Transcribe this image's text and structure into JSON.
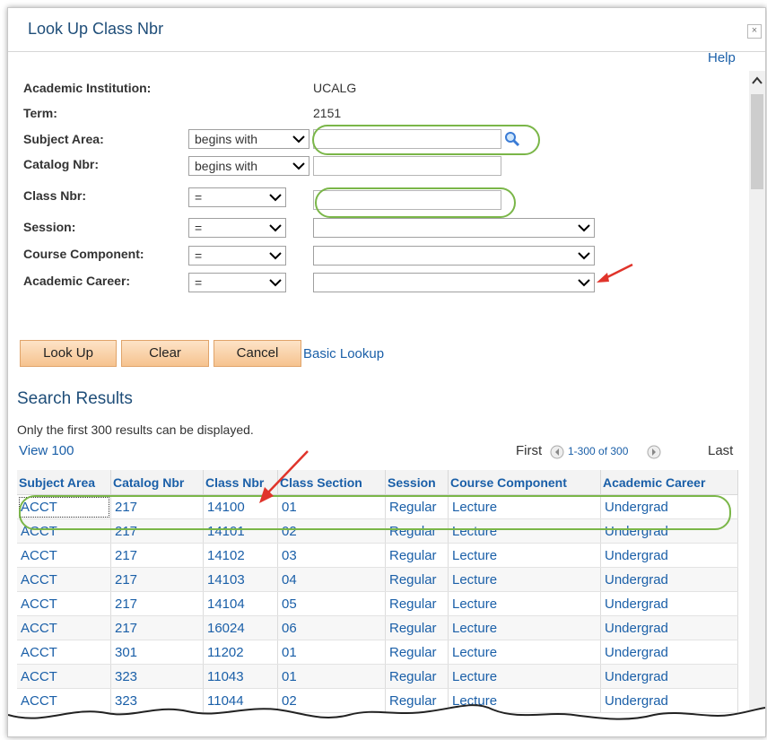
{
  "dialog": {
    "title": "Look Up Class Nbr",
    "close_glyph": "×",
    "help": "Help"
  },
  "fields": {
    "academic_institution": {
      "label": "Academic Institution:",
      "value": "UCALG"
    },
    "term": {
      "label": "Term:",
      "value": "2151"
    },
    "subject_area": {
      "label": "Subject Area:",
      "operator": "begins with"
    },
    "catalog_nbr": {
      "label": "Catalog Nbr:",
      "operator": "begins with"
    },
    "class_nbr": {
      "label": "Class Nbr:",
      "operator": "="
    },
    "session": {
      "label": "Session:",
      "operator": "="
    },
    "course_component": {
      "label": "Course Component:",
      "operator": "="
    },
    "academic_career": {
      "label": "Academic Career:",
      "operator": "="
    }
  },
  "buttons": {
    "look_up": "Look Up",
    "clear": "Clear",
    "cancel": "Cancel",
    "basic_lookup": "Basic Lookup"
  },
  "results": {
    "title": "Search Results",
    "note": "Only the first 300 results can be displayed.",
    "view": "View 100",
    "first": "First",
    "range": "1-300 of 300",
    "last": "Last",
    "columns": [
      "Subject Area",
      "Catalog Nbr",
      "Class Nbr",
      "Class Section",
      "Session",
      "Course Component",
      "Academic Career"
    ],
    "rows": [
      [
        "ACCT",
        "217",
        "14100",
        "01",
        "Regular",
        "Lecture",
        "Undergrad"
      ],
      [
        "ACCT",
        "217",
        "14101",
        "02",
        "Regular",
        "Lecture",
        "Undergrad"
      ],
      [
        "ACCT",
        "217",
        "14102",
        "03",
        "Regular",
        "Lecture",
        "Undergrad"
      ],
      [
        "ACCT",
        "217",
        "14103",
        "04",
        "Regular",
        "Lecture",
        "Undergrad"
      ],
      [
        "ACCT",
        "217",
        "14104",
        "05",
        "Regular",
        "Lecture",
        "Undergrad"
      ],
      [
        "ACCT",
        "217",
        "16024",
        "06",
        "Regular",
        "Lecture",
        "Undergrad"
      ],
      [
        "ACCT",
        "301",
        "11202",
        "01",
        "Regular",
        "Lecture",
        "Undergrad"
      ],
      [
        "ACCT",
        "323",
        "11043",
        "01",
        "Regular",
        "Lecture",
        "Undergrad"
      ],
      [
        "ACCT",
        "323",
        "11044",
        "02",
        "Regular",
        "Lecture",
        "Undergrad"
      ]
    ]
  },
  "colors": {
    "accent": "#1a5fa8",
    "highlight": "#7ab648",
    "arrow": "#e0342b",
    "button": "#f6c38f"
  }
}
